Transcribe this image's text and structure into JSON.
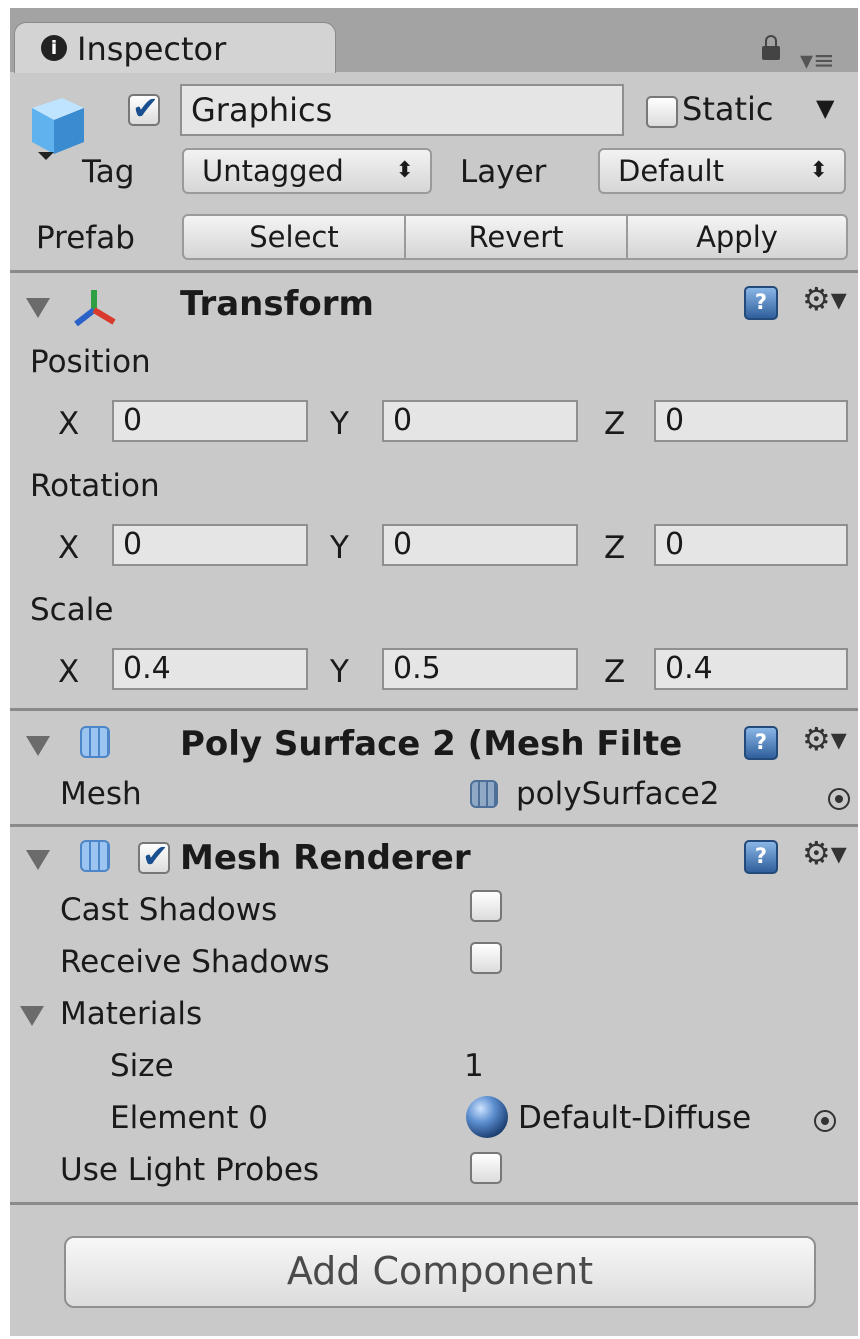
{
  "window": {
    "tab_label": "Inspector"
  },
  "header": {
    "object_name": "Graphics",
    "active": true,
    "static_label": "Static",
    "static_checked": false,
    "tag_label": "Tag",
    "tag_value": "Untagged",
    "layer_label": "Layer",
    "layer_value": "Default",
    "prefab_label": "Prefab",
    "prefab_buttons": [
      "Select",
      "Revert",
      "Apply"
    ]
  },
  "transform": {
    "title": "Transform",
    "position_label": "Position",
    "rotation_label": "Rotation",
    "scale_label": "Scale",
    "axes": [
      "X",
      "Y",
      "Z"
    ],
    "position": [
      "0",
      "0",
      "0"
    ],
    "rotation": [
      "0",
      "0",
      "0"
    ],
    "scale": [
      "0.4",
      "0.5",
      "0.4"
    ]
  },
  "mesh_filter": {
    "title": "Poly Surface 2 (Mesh Filte",
    "mesh_label": "Mesh",
    "mesh_value": "polySurface2"
  },
  "mesh_renderer": {
    "title": "Mesh Renderer",
    "enabled": true,
    "cast_shadows_label": "Cast Shadows",
    "cast_shadows": false,
    "receive_shadows_label": "Receive Shadows",
    "receive_shadows": false,
    "materials_label": "Materials",
    "size_label": "Size",
    "size_value": "1",
    "element0_label": "Element 0",
    "element0_value": "Default-Diffuse",
    "use_light_probes_label": "Use Light Probes",
    "use_light_probes": false
  },
  "footer": {
    "add_component_label": "Add Component"
  },
  "icons": {
    "info": "info-icon",
    "lock": "lock-icon",
    "menu": "menu-icon",
    "help": "help-icon",
    "settings": "gear-icon",
    "help_glyph": "?",
    "gear_glyph": "⚙▾"
  },
  "colors": {
    "panel_bg": "#c9c9c9",
    "accent_blue": "#2f5f9c"
  }
}
